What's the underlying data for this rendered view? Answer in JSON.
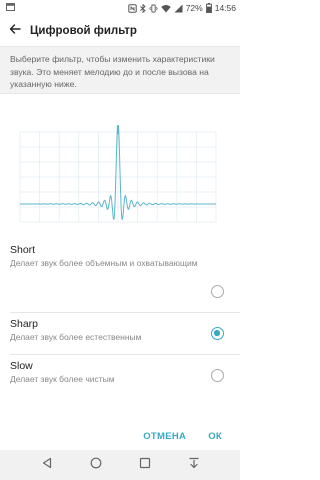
{
  "status_bar": {
    "battery_percent": "72%",
    "time": "14:56"
  },
  "app_bar": {
    "title": "Цифровой фильтр"
  },
  "description": "Выберите фильтр, чтобы изменить характеристики звука. Это меняет мелодию до и после вызова на указанную ниже.",
  "options": [
    {
      "title": "Short",
      "desc": "Делает звук более объемным и охватывающим",
      "checked": false
    },
    {
      "title": "Sharp",
      "desc": "Делает звук более естественным",
      "checked": true
    },
    {
      "title": "Slow",
      "desc": "Делает звук более чистым",
      "checked": false
    }
  ],
  "actions": {
    "cancel_label": "ОТМЕНА",
    "ok_label": "ОК"
  },
  "colors": {
    "accent": "#38a8c4",
    "waveform": "#5bb5c8"
  }
}
